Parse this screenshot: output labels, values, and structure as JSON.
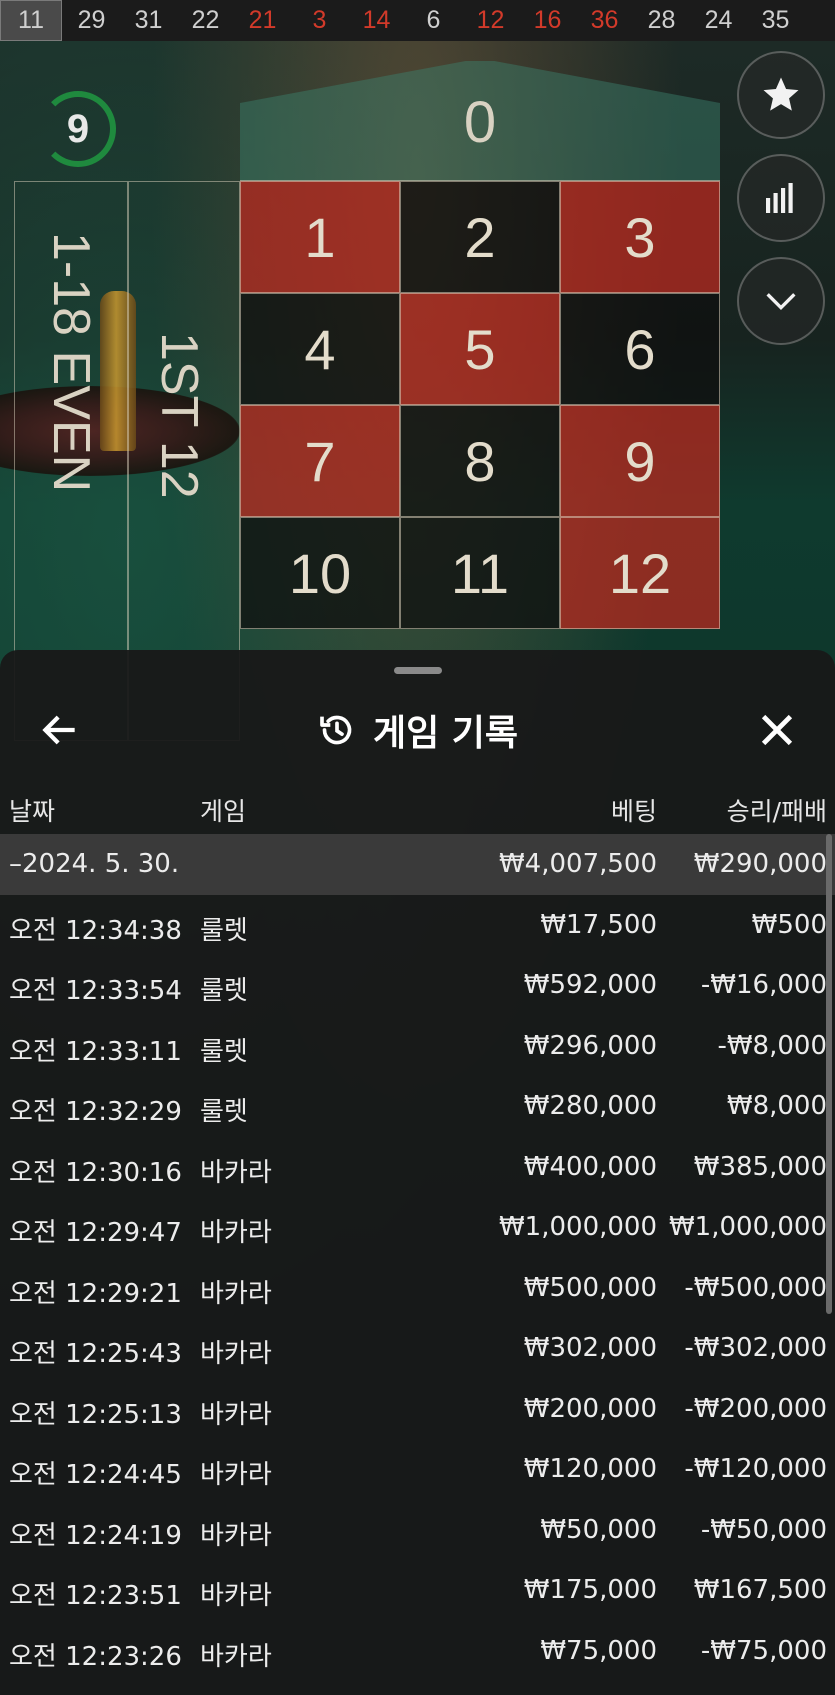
{
  "results_strip": [
    {
      "value": "11",
      "color": "black",
      "latest": true
    },
    {
      "value": "29",
      "color": "black"
    },
    {
      "value": "31",
      "color": "black"
    },
    {
      "value": "22",
      "color": "black"
    },
    {
      "value": "21",
      "color": "red"
    },
    {
      "value": "3",
      "color": "red"
    },
    {
      "value": "14",
      "color": "red"
    },
    {
      "value": "6",
      "color": "black"
    },
    {
      "value": "12",
      "color": "red"
    },
    {
      "value": "16",
      "color": "red"
    },
    {
      "value": "36",
      "color": "red"
    },
    {
      "value": "28",
      "color": "black"
    },
    {
      "value": "24",
      "color": "black"
    },
    {
      "value": "35",
      "color": "black"
    }
  ],
  "timer": {
    "value": "9"
  },
  "board": {
    "zero": "0",
    "low_even_label": "1-18 EVEN",
    "dozen_label": "1ST 12",
    "numbers": [
      {
        "n": "1",
        "color": "red"
      },
      {
        "n": "2",
        "color": "black"
      },
      {
        "n": "3",
        "color": "red"
      },
      {
        "n": "4",
        "color": "black"
      },
      {
        "n": "5",
        "color": "red"
      },
      {
        "n": "6",
        "color": "black"
      },
      {
        "n": "7",
        "color": "red"
      },
      {
        "n": "8",
        "color": "black"
      },
      {
        "n": "9",
        "color": "red"
      },
      {
        "n": "10",
        "color": "black"
      },
      {
        "n": "11",
        "color": "black"
      },
      {
        "n": "12",
        "color": "red"
      }
    ]
  },
  "right_buttons": [
    "star-icon",
    "stats-icon",
    "chevron-down-icon"
  ],
  "history": {
    "title": "게임 기록",
    "columns": {
      "date": "날짜",
      "game": "게임",
      "bet": "베팅",
      "result": "승리/패배"
    },
    "date_row": {
      "label": "–2024. 5. 30.",
      "bet": "₩4,007,500",
      "result": "₩290,000"
    },
    "rows": [
      {
        "time": "오전 12:34:38",
        "game": "룰렛",
        "bet": "₩17,500",
        "result": "₩500"
      },
      {
        "time": "오전 12:33:54",
        "game": "룰렛",
        "bet": "₩592,000",
        "result": "-₩16,000"
      },
      {
        "time": "오전 12:33:11",
        "game": "룰렛",
        "bet": "₩296,000",
        "result": "-₩8,000"
      },
      {
        "time": "오전 12:32:29",
        "game": "룰렛",
        "bet": "₩280,000",
        "result": "₩8,000"
      },
      {
        "time": "오전 12:30:16",
        "game": "바카라",
        "bet": "₩400,000",
        "result": "₩385,000"
      },
      {
        "time": "오전 12:29:47",
        "game": "바카라",
        "bet": "₩1,000,000",
        "result": "₩1,000,000"
      },
      {
        "time": "오전 12:29:21",
        "game": "바카라",
        "bet": "₩500,000",
        "result": "-₩500,000"
      },
      {
        "time": "오전 12:25:43",
        "game": "바카라",
        "bet": "₩302,000",
        "result": "-₩302,000"
      },
      {
        "time": "오전 12:25:13",
        "game": "바카라",
        "bet": "₩200,000",
        "result": "-₩200,000"
      },
      {
        "time": "오전 12:24:45",
        "game": "바카라",
        "bet": "₩120,000",
        "result": "-₩120,000"
      },
      {
        "time": "오전 12:24:19",
        "game": "바카라",
        "bet": "₩50,000",
        "result": "-₩50,000"
      },
      {
        "time": "오전 12:23:51",
        "game": "바카라",
        "bet": "₩175,000",
        "result": "₩167,500"
      },
      {
        "time": "오전 12:23:26",
        "game": "바카라",
        "bet": "₩75,000",
        "result": "-₩75,000"
      }
    ]
  }
}
